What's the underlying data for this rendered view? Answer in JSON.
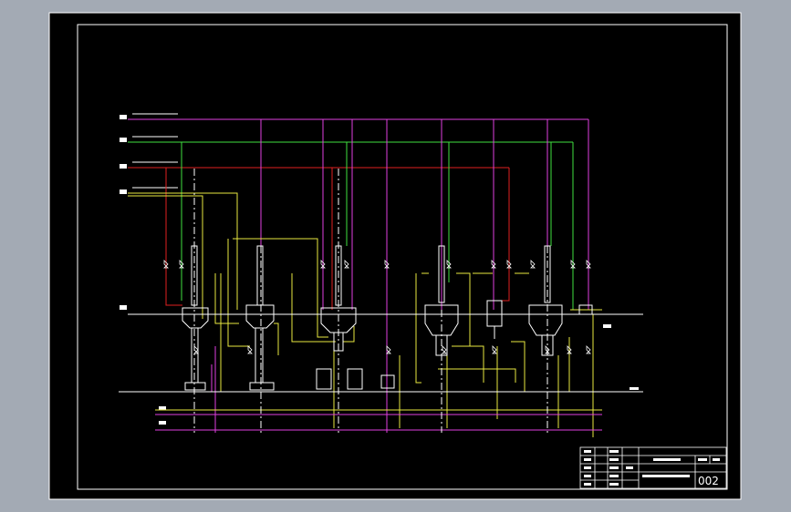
{
  "colors": {
    "background": "#a3aab4",
    "sheet": "#000000",
    "frame": "#ffffff",
    "magenta": "#e040e0",
    "green": "#40e040",
    "red": "#e02020",
    "yellow": "#e8e840",
    "white": "#ffffff"
  },
  "title_block": {
    "drawing_number": "002"
  }
}
